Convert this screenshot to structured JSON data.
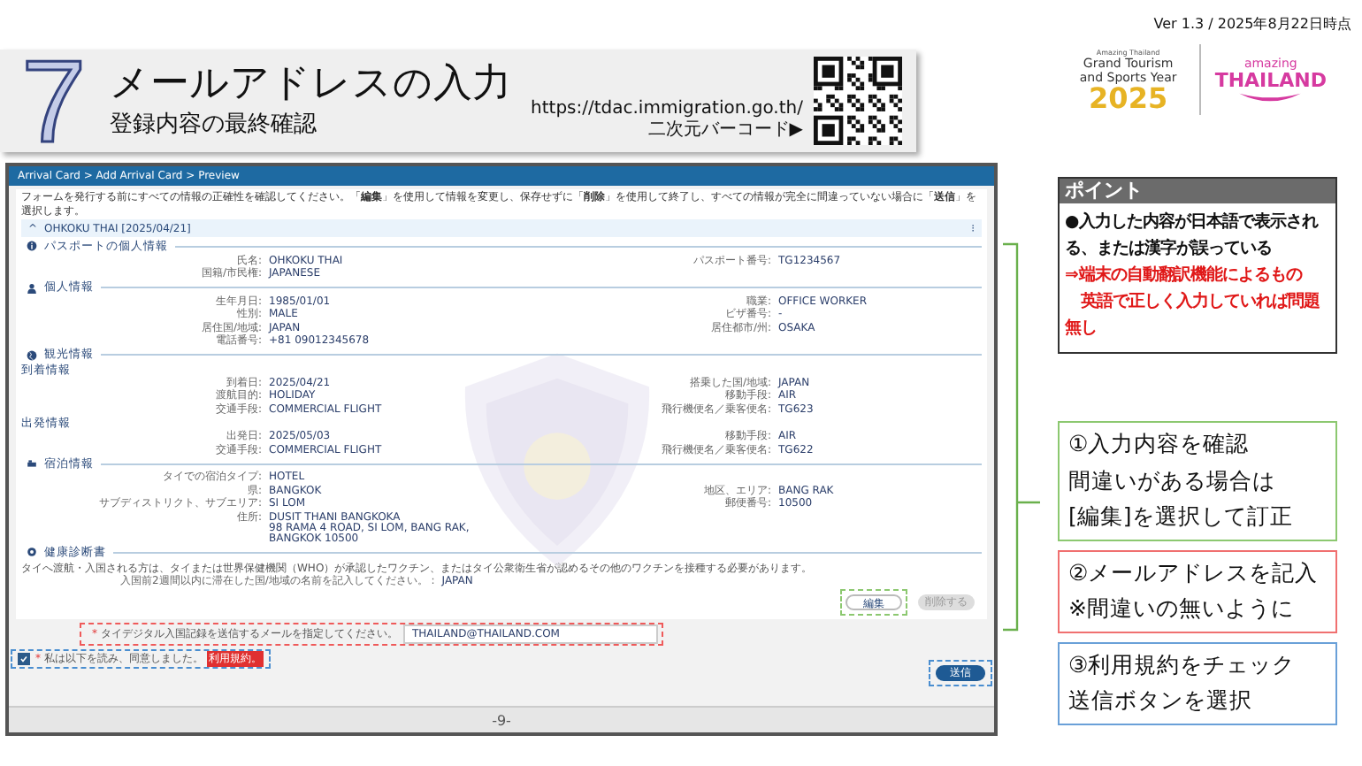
{
  "slide": {
    "version": "Ver 1.3 / 2025年8月22日時点",
    "step_number": "7",
    "title": "メールアドレスの入力",
    "subtitle": "登録内容の最終確認",
    "url": "https://tdac.immigration.go.th/",
    "qr_label": "二次元バーコード▶",
    "logo": {
      "tagline": "Amazing Thailand",
      "name": "Grand Tourism and Sports Year",
      "year": "2025",
      "brand_small": "amazing",
      "brand": "THAILAND"
    }
  },
  "screen": {
    "breadcrumb": "Arrival Card > Add Arrival Card > Preview",
    "instruction": "フォームを発行する前にすべての情報の正確性を確認してください。「**編集**」を使用して情報を変更し、保存せずに「**削除**」を使用して終了し、すべての情報が完全に間違っていない場合に「**送信**」を選択します。",
    "record": {
      "caret": "^",
      "title": "OHKOKU THAI [2025/04/21]",
      "expanded": true,
      "menu": "⁝"
    },
    "sections": [
      {
        "title": "パスポートの個人情報",
        "groups": [
          {
            "rows": [
              {
                "left": {
                  "label": "氏名:",
                  "value": "OHKOKU THAI"
                },
                "right": {
                  "label": "パスポート番号:",
                  "value": "TG1234567"
                }
              },
              {
                "left": {
                  "label": "国籍/市民権:",
                  "value": "JAPANESE"
                }
              }
            ]
          }
        ]
      },
      {
        "title": "個人情報",
        "groups": [
          {
            "rows": [
              {
                "left": {
                  "label": "生年月日:",
                  "value": "1985/01/01"
                },
                "right": {
                  "label": "職業:",
                  "value": "OFFICE WORKER"
                }
              },
              {
                "left": {
                  "label": "性別:",
                  "value": "MALE"
                },
                "right": {
                  "label": "ビザ番号:",
                  "value": "-"
                }
              },
              {
                "left": {
                  "label": "居住国/地域:",
                  "value": "JAPAN"
                },
                "right": {
                  "label": "居住都市/州:",
                  "value": "OSAKA"
                }
              },
              {
                "left": {
                  "label": "電話番号:",
                  "value": "+81 09012345678"
                }
              }
            ]
          }
        ]
      },
      {
        "title": "観光情報",
        "groups": [
          {
            "heading": "到着情報",
            "rows": [
              {
                "left": {
                  "label": "到着日:",
                  "value": "2025/04/21"
                },
                "right": {
                  "label": "搭乗した国/地域:",
                  "value": "JAPAN"
                }
              },
              {
                "left": {
                  "label": "渡航目的:",
                  "value": "HOLIDAY"
                },
                "right": {
                  "label": "移動手段:",
                  "value": "AIR"
                }
              },
              {
                "left": {
                  "label": "交通手段:",
                  "value": "COMMERCIAL FLIGHT"
                },
                "right": {
                  "label": "飛行機便名／乗客便名:",
                  "value": "TG623"
                }
              }
            ]
          },
          {
            "heading": "出発情報",
            "rows": [
              {
                "left": {
                  "label": "出発日:",
                  "value": "2025/05/03"
                },
                "right": {
                  "label": "移動手段:",
                  "value": "AIR"
                }
              },
              {
                "left": {
                  "label": "交通手段:",
                  "value": "COMMERCIAL FLIGHT"
                },
                "right": {
                  "label": "飛行機便名／乗客便名:",
                  "value": "TG622"
                }
              }
            ]
          }
        ]
      },
      {
        "title": "宿泊情報",
        "groups": [
          {
            "rows": [
              {
                "left": {
                  "label": "タイでの宿泊タイプ:",
                  "value": "HOTEL"
                }
              },
              {
                "left": {
                  "label": "県:",
                  "value": "BANGKOK"
                },
                "right": {
                  "label": "地区、エリア:",
                  "value": "BANG RAK"
                }
              },
              {
                "left": {
                  "label": "サブディストリクト、サブエリア:",
                  "value": "SI LOM"
                },
                "right": {
                  "label": "郵便番号:",
                  "value": "10500"
                }
              },
              {
                "left": {
                  "label": "住所:",
                  "value": [
                    "DUSIT THANI BANGKOKA",
                    "98 RAMA 4 ROAD, SI LOM, BANG RAK, BANGKOK 10500"
                  ]
                }
              }
            ]
          }
        ]
      },
      {
        "title": "健康診断書"
      }
    ],
    "health": {
      "note": "タイへ渡航・入国される方は、タイまたは世界保健機関（WHO）が承認したワクチン、またはタイ公衆衛生省が認めるその他のワクチンを接種する必要があります。",
      "question": "入国前2週間以内に滞在した国/地域の名前を記入してください。 :",
      "answer": "JAPAN"
    },
    "actions": [
      {
        "label": "編集",
        "kind": "outline"
      },
      {
        "label": "削除する",
        "kind": "muted"
      }
    ],
    "email": {
      "required": "*",
      "label": "タイデジタル入国記録を送信するメールを指定してください。",
      "value": "THAILAND@THAILAND.COM"
    },
    "agree": {
      "checked": true,
      "required": "*",
      "text": "私は以下を読み、同意しました。",
      "link": "利用規約。"
    },
    "submit": "送信",
    "page_number": "-9-"
  },
  "point": {
    "title": "ポイント",
    "paragraphs": [
      {
        "text": "●入力した内容が日本語で表示される、または漢字が誤っている",
        "kind": "normal"
      },
      {
        "text": "⇒端末の自動翻訳機能によるもの",
        "kind": "warning"
      },
      {
        "text": "　英語で正しく入力していれば問題無し",
        "kind": "warning"
      }
    ]
  },
  "steps": [
    {
      "lines": [
        "①入力内容を確認",
        "間違いがある場合は",
        "[編集]を選択して訂正"
      ],
      "color": "#8cc870"
    },
    {
      "lines": [
        "②メールアドレスを記入",
        "※間違いの無いように"
      ],
      "color": "#f07070"
    },
    {
      "lines": [
        "③利用規約をチェック",
        "送信ボタンを選択"
      ],
      "color": "#6aa0d8"
    }
  ]
}
